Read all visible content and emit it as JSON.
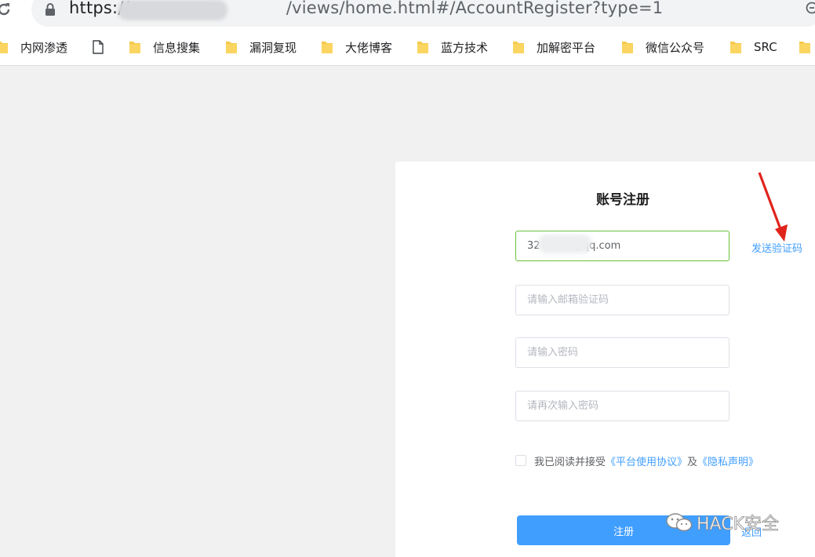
{
  "browser": {
    "url_scheme": "https://",
    "url_path": "/views/home.html#/AccountRegister?type=1",
    "icons": {
      "reload": "reload-icon",
      "lock": "lock-icon",
      "zoom": "zoom-icon"
    }
  },
  "bookmarks": [
    {
      "label": "内网渗透",
      "icon": "folder-icon"
    },
    {
      "label": "",
      "icon": "page-icon"
    },
    {
      "label": "信息搜集",
      "icon": "folder-icon"
    },
    {
      "label": "漏洞复现",
      "icon": "folder-icon"
    },
    {
      "label": "大佬博客",
      "icon": "folder-icon"
    },
    {
      "label": "蓝方技术",
      "icon": "folder-icon"
    },
    {
      "label": "加解密平台",
      "icon": "folder-icon"
    },
    {
      "label": "微信公众号",
      "icon": "folder-icon"
    },
    {
      "label": "SRC",
      "icon": "folder-icon"
    }
  ],
  "register": {
    "title": "账号注册",
    "email_value": "32        3@qq.com",
    "send_code_label": "发送验证码",
    "code_placeholder": "请输入邮箱验证码",
    "password_placeholder": "请输入密码",
    "confirm_placeholder": "请再次输入密码",
    "agree_prefix": "我已阅读并接受",
    "agree_terms": "《平台使用协议》",
    "agree_and": "及",
    "agree_privacy": "《隐私声明》",
    "submit_label": "注册",
    "back_label": "返回"
  },
  "watermark": {
    "text": "HACK安全",
    "icon": "wechat-icon"
  },
  "colors": {
    "primary": "#409eff",
    "active_border": "#67c23a",
    "annotation_arrow": "#e0241b",
    "folder": "#f6c94a"
  }
}
